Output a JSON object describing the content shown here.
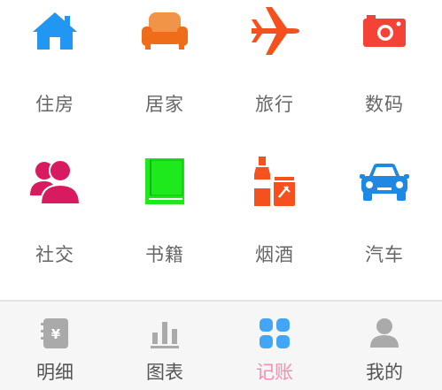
{
  "categories": [
    {
      "label": "住房",
      "icon": "house-icon",
      "color": "#2196f3"
    },
    {
      "label": "居家",
      "icon": "sofa-icon",
      "color": "#ef6c1a"
    },
    {
      "label": "旅行",
      "icon": "airplane-icon",
      "color": "#f4511e"
    },
    {
      "label": "数码",
      "icon": "camera-icon",
      "color": "#f44336"
    },
    {
      "label": "社交",
      "icon": "people-icon",
      "color": "#d81b60"
    },
    {
      "label": "书籍",
      "icon": "book-icon",
      "color": "#1de91d"
    },
    {
      "label": "烟酒",
      "icon": "bottle-lighter-icon",
      "color": "#f4511e"
    },
    {
      "label": "汽车",
      "icon": "car-icon",
      "color": "#1e88e5"
    }
  ],
  "tabbar": {
    "tabs": [
      {
        "label": "明细",
        "icon": "ledger-icon",
        "active": false
      },
      {
        "label": "图表",
        "icon": "bar-chart-icon",
        "active": false
      },
      {
        "label": "记账",
        "icon": "grid-four-icon",
        "active": true
      },
      {
        "label": "我的",
        "icon": "user-icon",
        "active": false
      }
    ],
    "inactive_color": "#aaaaaa",
    "active_color": "#42a5f5",
    "active_label_color": "#f48fb1"
  }
}
